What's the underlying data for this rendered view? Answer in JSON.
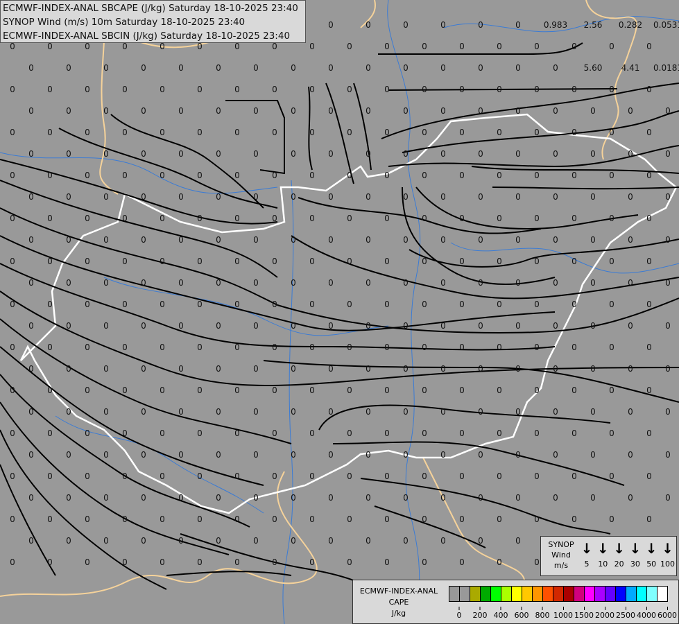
{
  "header": {
    "lines": [
      "ECMWF-INDEX-ANAL SBCAPE (J/kg) Saturday 18-10-2025 23:40",
      "SYNOP Wind (m/s) 10m Saturday 18-10-2025 23:40",
      "ECMWF-INDEX-ANAL SBCIN (J/kg) Saturday 18-10-2025 23:40"
    ]
  },
  "field": {
    "default_value": "0",
    "nonzero_labels": [
      {
        "row": 0,
        "col": 14,
        "value": "0.983"
      },
      {
        "row": 0,
        "col": 15,
        "value": "2.56"
      },
      {
        "row": 0,
        "col": 16,
        "value": "0.282"
      },
      {
        "row": 0,
        "col": 17,
        "value": "0.0531"
      },
      {
        "row": 2,
        "col": 15,
        "value": "5.60"
      },
      {
        "row": 2,
        "col": 16,
        "value": "4.41"
      },
      {
        "row": 2,
        "col": 17,
        "value": "0.0181"
      }
    ]
  },
  "wind_legend": {
    "title_lines": [
      "SYNOP",
      "Wind",
      "m/s"
    ],
    "speeds": [
      "5",
      "10",
      "20",
      "30",
      "50",
      "100"
    ],
    "arrow_icon": "down-arrow"
  },
  "cape_legend": {
    "title_lines": [
      "ECMWF-INDEX-ANAL",
      "CAPE",
      "J/kg"
    ],
    "colors": [
      "#999999",
      "#999999",
      "#aaaa00",
      "#00aa00",
      "#00ff00",
      "#aaff00",
      "#ffff00",
      "#ffc800",
      "#ff9600",
      "#ff5000",
      "#d22800",
      "#aa0000",
      "#d2007d",
      "#ff00ff",
      "#aa00ff",
      "#6400ff",
      "#0000ff",
      "#00aaff",
      "#00ffff",
      "#80ffff",
      "#ffffff"
    ],
    "tick_labels": [
      "0",
      "200",
      "400",
      "600",
      "800",
      "1000",
      "1500",
      "2000",
      "2500",
      "4000",
      "6000"
    ]
  },
  "colors": {
    "background": "#999999",
    "country_border": "#f5d29a",
    "focus_border": "#ffffff",
    "rivers": "#3a7bd5",
    "streamlines": "#000000"
  }
}
